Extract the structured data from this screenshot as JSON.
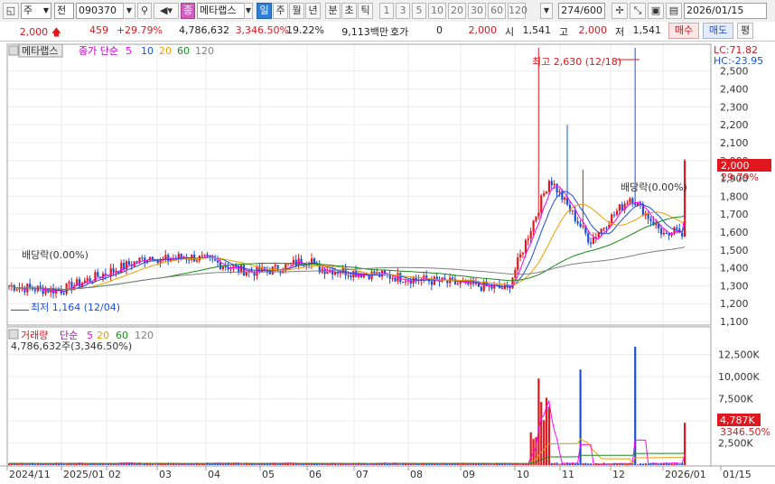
{
  "toolbar": {
    "type_select": "주",
    "market_select": "전",
    "code": "090370",
    "stock_badge": "종",
    "name": "메타랩스",
    "periods": [
      "일",
      "주",
      "월",
      "년",
      "분",
      "초",
      "틱"
    ],
    "active_period": "일",
    "intervals": [
      "1",
      "3",
      "5",
      "10",
      "20",
      "30",
      "60",
      "120"
    ],
    "count": "274",
    "count_total": "/600",
    "date": "2026/01/15"
  },
  "quote": {
    "price": "2,000",
    "change": "459",
    "change_pct": "+29.79%",
    "volume": "4,786,632",
    "volume_pct": "3,346.50%",
    "turnover": "19.22%",
    "amount": "9,113백만",
    "hoga_label": "호가",
    "hoga_value": "0",
    "hoga_price": "2,000",
    "open_label": "시",
    "open": "1,541",
    "high_label": "고",
    "high": "2,000",
    "low_label": "저",
    "low": "1,541",
    "buy_btn": "매수",
    "sell_btn": "매도",
    "eval_btn": "평",
    "colors": {
      "up": "#e0171f",
      "down": "#1a50d8"
    }
  },
  "price_panel": {
    "name_tab": "메타랩스",
    "ma_label": "종가 단순",
    "ma_periods": [
      "5",
      "10",
      "20",
      "60",
      "120"
    ],
    "ma_colors": [
      "#ff00ff",
      "#1a50d8",
      "#e8a000",
      "#1a8a1a",
      "#808080"
    ],
    "lc": "LC:71.82",
    "hc": "HC:-23.95",
    "high_note": "최고 2,630 (12/18)",
    "low_note": "최저 1,164 (12/04)",
    "div_left": "배당락(0.00%)",
    "div_right": "배당락(0.00%)",
    "last_price": "2,000",
    "last_pct": "29.79%"
  },
  "volume_panel": {
    "name": "거래량",
    "ma_label": "단순",
    "ma_periods": [
      "5",
      "20",
      "60",
      "120"
    ],
    "total": "4,786,632주(3,346.50%)",
    "last_volume": "4,787K",
    "last_pct": "3346.50%"
  },
  "chart_data": {
    "type": "candlestick",
    "price_axis": {
      "ticks": [
        "2,500",
        "2,400",
        "2,300",
        "2,200",
        "2,100",
        "2,000",
        "1,900",
        "1,800",
        "1,700",
        "1,600",
        "1,500",
        "1,400",
        "1,300",
        "1,200",
        "1,100"
      ],
      "ylim": [
        1080,
        2650
      ]
    },
    "volume_axis": {
      "ticks": [
        "12,500K",
        "10,000K",
        "7,500K",
        "5,000K",
        "2,500K"
      ],
      "ylim": [
        0,
        14000
      ]
    },
    "x_ticks": [
      "2024/11",
      "2025/01",
      "02",
      "03",
      "04",
      "05",
      "06",
      "07",
      "08",
      "09",
      "10",
      "11",
      "12",
      "2026/01",
      "01/15"
    ],
    "series": [
      {
        "name": "최고",
        "x": "12/18",
        "y": 2630
      },
      {
        "name": "최저",
        "x": "12/04",
        "y": 1164
      }
    ],
    "last_close": 2000,
    "last_volume_k": 4787
  }
}
